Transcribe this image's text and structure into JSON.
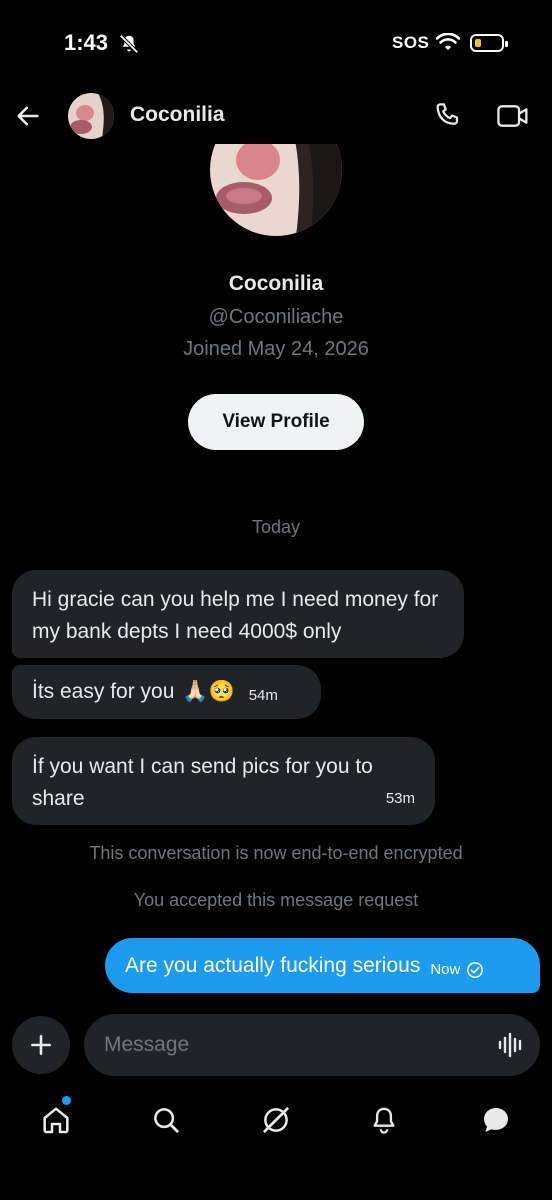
{
  "status_bar": {
    "time": "1:43",
    "sos": "SOS"
  },
  "header": {
    "name": "Coconilia"
  },
  "profile": {
    "name": "Coconilia",
    "handle": "@Coconiliache",
    "joined": "Joined May 24, 2026",
    "view_profile_label": "View Profile"
  },
  "conversation": {
    "date_divider": "Today",
    "messages": [
      {
        "text": "Hi gracie can you help me I need money for my bank depts I need 4000$ only",
        "time": ""
      },
      {
        "text": "İts easy for you",
        "emoji": "🙏🏻🥺",
        "time": "54m"
      },
      {
        "text": "İf you want I can send pics for you to share",
        "time": "53m"
      }
    ],
    "system_1": "This conversation is now end-to-end encrypted",
    "system_2": "You accepted this message request",
    "outgoing": {
      "text": "Are you actually fucking serious",
      "time": "Now"
    }
  },
  "composer": {
    "placeholder": "Message"
  },
  "colors": {
    "accent": "#1d9bf0",
    "bubble": "#202327",
    "muted": "#71767b"
  },
  "icons": [
    "back-arrow-icon",
    "phone-icon",
    "video-icon",
    "plus-icon",
    "voice-icon",
    "home-icon",
    "search-icon",
    "grok-icon",
    "bell-icon",
    "messages-icon"
  ]
}
